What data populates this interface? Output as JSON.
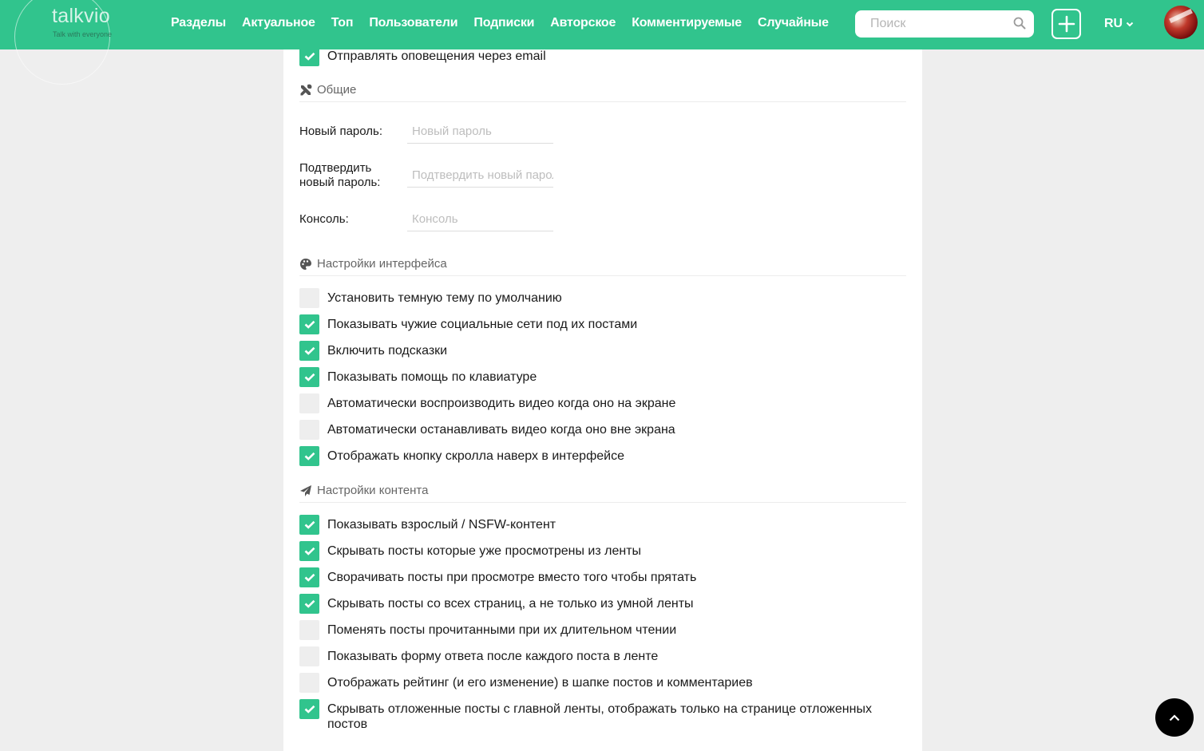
{
  "header": {
    "logo_title": "talkvio",
    "logo_subtitle": "Talk with everyone",
    "nav": [
      {
        "label": "Разделы"
      },
      {
        "label": "Актуальное"
      },
      {
        "label": "Топ"
      },
      {
        "label": "Пользователи"
      },
      {
        "label": "Подписки"
      },
      {
        "label": "Авторское"
      },
      {
        "label": "Комментируемые"
      },
      {
        "label": "Случайные"
      }
    ],
    "search_placeholder": "Поиск",
    "search_value": "",
    "language": "RU",
    "accent_color": "#31c48d"
  },
  "notifications": {
    "email_label": "Отправлять оповещения через email",
    "email_checked": true
  },
  "general": {
    "title": "Общие",
    "icon": "tools-icon",
    "fields": [
      {
        "label": "Новый пароль:",
        "placeholder": "Новый пароль",
        "value": ""
      },
      {
        "label": "Подтвердить новый пароль:",
        "placeholder": "Подтвердить новый пароль",
        "value": ""
      },
      {
        "label": "Консоль:",
        "placeholder": "Консоль",
        "value": ""
      }
    ]
  },
  "interface": {
    "title": "Настройки интерфейса",
    "icon": "palette-icon",
    "options": [
      {
        "label": "Установить темную тему по умолчанию",
        "checked": false
      },
      {
        "label": "Показывать чужие социальные сети под их постами",
        "checked": true
      },
      {
        "label": "Включить подсказки",
        "checked": true
      },
      {
        "label": "Показывать помощь по клавиатуре",
        "checked": true
      },
      {
        "label": "Автоматически воспроизводить видео когда оно на экране",
        "checked": false
      },
      {
        "label": "Автоматически останавливать видео когда оно вне экрана",
        "checked": false
      },
      {
        "label": "Отображать кнопку скролла наверх в интерфейсе",
        "checked": true
      }
    ]
  },
  "content": {
    "title": "Настройки контента",
    "icon": "paper-plane-icon",
    "options": [
      {
        "label": "Показывать взрослый / NSFW-контент",
        "checked": true
      },
      {
        "label": "Скрывать посты которые уже просмотрены из ленты",
        "checked": true
      },
      {
        "label": "Сворачивать посты при просмотре вместо того чтобы прятать",
        "checked": true
      },
      {
        "label": "Скрывать посты со всех страниц, а не только из умной ленты",
        "checked": true
      },
      {
        "label": "Поменять посты прочитанными при их длительном чтении",
        "checked": false
      },
      {
        "label": "Показывать форму ответа после каждого поста в ленте",
        "checked": false
      },
      {
        "label": "Отображать рейтинг (и его изменение) в шапке постов и комментариев",
        "checked": false
      },
      {
        "label": "Скрывать отложенные посты с главной ленты, отображать только на странице отложенных постов",
        "checked": true
      }
    ]
  }
}
